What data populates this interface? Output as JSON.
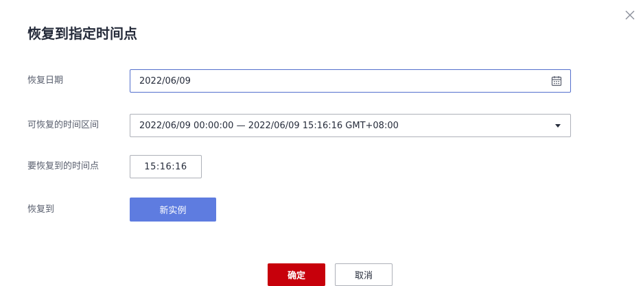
{
  "dialog": {
    "title": "恢复到指定时间点",
    "close_icon": "close-icon"
  },
  "form": {
    "restore_date": {
      "label": "恢复日期",
      "value": "2022/06/09",
      "icon": "calendar-icon"
    },
    "time_range": {
      "label": "可恢复的时间区间",
      "value": "2022/06/09 00:00:00 — 2022/06/09 15:16:16 GMT+08:00",
      "icon": "chevron-down-icon"
    },
    "restore_time": {
      "label": "要恢复到的时间点",
      "value": "15:16:16"
    },
    "restore_to": {
      "label": "恢复到",
      "option": "新实例"
    }
  },
  "footer": {
    "confirm_label": "确定",
    "cancel_label": "取消"
  },
  "colors": {
    "primary": "#5e7ce0",
    "danger": "#c7000b",
    "focus_border": "#526ecc",
    "border": "#adb0b8"
  }
}
